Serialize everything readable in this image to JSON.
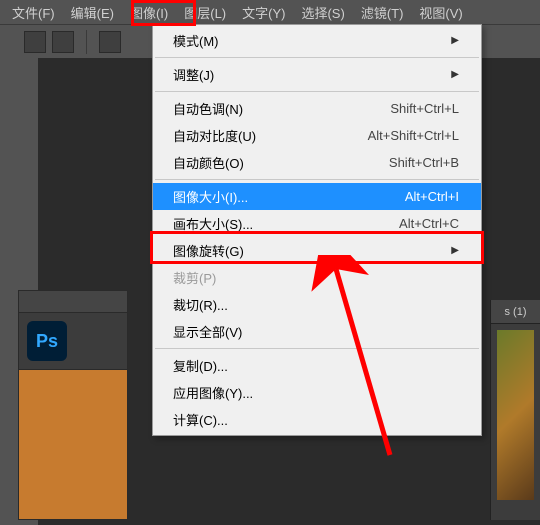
{
  "menubar": {
    "items": [
      {
        "label": "文件(F)"
      },
      {
        "label": "编辑(E)"
      },
      {
        "label": "图像(I)"
      },
      {
        "label": "图层(L)"
      },
      {
        "label": "文字(Y)"
      },
      {
        "label": "选择(S)"
      },
      {
        "label": "滤镜(T)"
      },
      {
        "label": "视图(V)"
      }
    ]
  },
  "dropdown": {
    "groups": [
      [
        {
          "label": "模式(M)",
          "submenu": true
        }
      ],
      [
        {
          "label": "调整(J)",
          "submenu": true
        }
      ],
      [
        {
          "label": "自动色调(N)",
          "shortcut": "Shift+Ctrl+L"
        },
        {
          "label": "自动对比度(U)",
          "shortcut": "Alt+Shift+Ctrl+L"
        },
        {
          "label": "自动颜色(O)",
          "shortcut": "Shift+Ctrl+B"
        }
      ],
      [
        {
          "label": "图像大小(I)...",
          "shortcut": "Alt+Ctrl+I",
          "selected": true
        },
        {
          "label": "画布大小(S)...",
          "shortcut": "Alt+Ctrl+C"
        },
        {
          "label": "图像旋转(G)",
          "submenu": true
        },
        {
          "label": "裁剪(P)",
          "disabled": true
        },
        {
          "label": "裁切(R)..."
        },
        {
          "label": "显示全部(V)"
        }
      ],
      [
        {
          "label": "复制(D)..."
        },
        {
          "label": "应用图像(Y)..."
        },
        {
          "label": "计算(C)..."
        }
      ]
    ]
  },
  "ps_badge": "Ps",
  "right_tab": "s (1)"
}
